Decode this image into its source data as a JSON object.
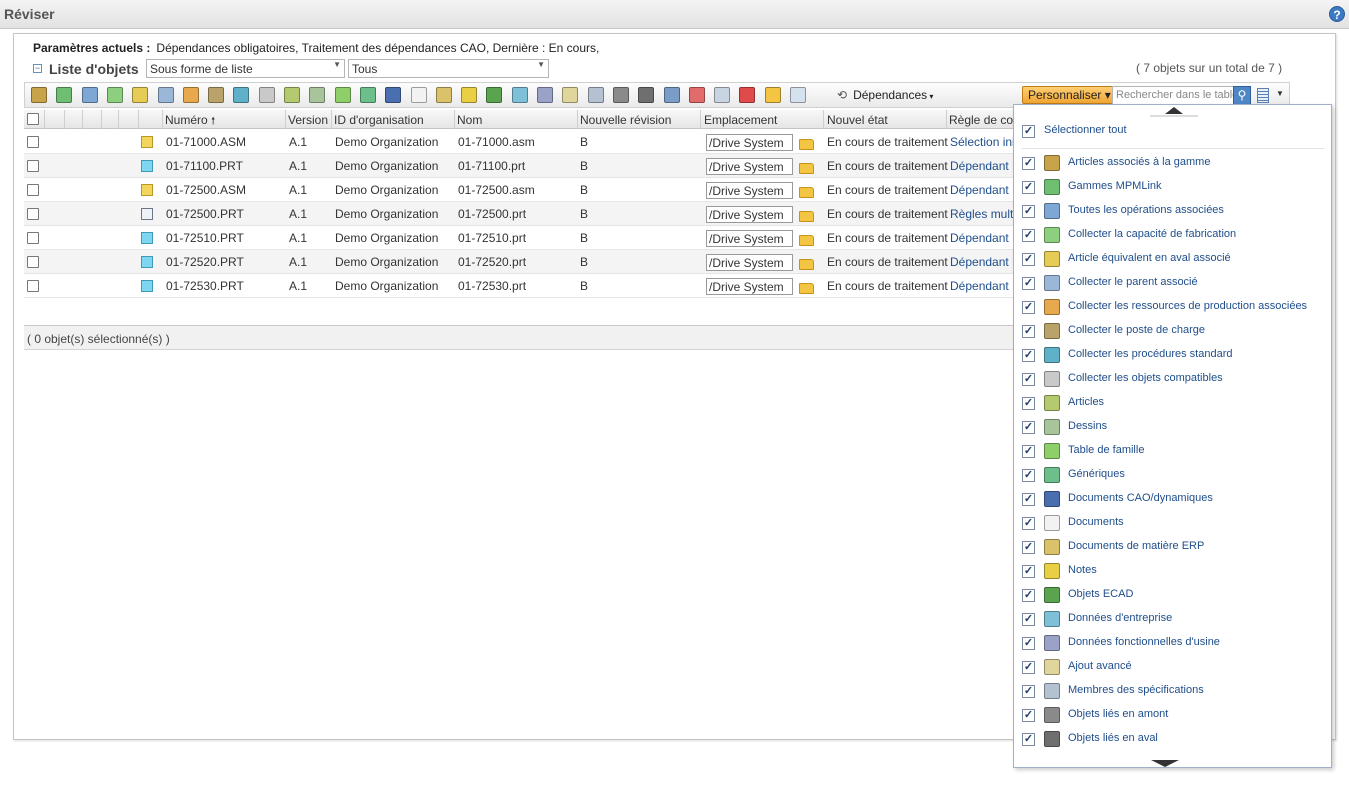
{
  "titlebar": {
    "title": "Réviser",
    "help": "?"
  },
  "params": {
    "label": "Paramètres actuels :",
    "value": "Dépendances obligatoires, Traitement des dépendances CAO, Dernière : En cours,"
  },
  "list": {
    "title": "Liste d'objets",
    "view_select": "Sous forme de liste",
    "filter_select": "Tous",
    "count": "( 7 objets sur un total de 7 )"
  },
  "toolbar": {
    "dependances": "Dépendances",
    "personnaliser": "Personnaliser",
    "search_placeholder": "Rechercher dans le table"
  },
  "columns": [
    "Numéro",
    "Version",
    "ID d'organisation",
    "Nom",
    "Nouvelle révision",
    "Emplacement",
    "Nouvel état",
    "Règle de coll"
  ],
  "rows": [
    {
      "number": "01-71000.ASM",
      "version": "A.1",
      "org": "Demo Organization",
      "name": "01-71000.asm",
      "revision": "B",
      "location": "/Drive System",
      "state": "En cours de traitement",
      "rule": "Sélection init",
      "icon": "assembly-icon"
    },
    {
      "number": "01-71100.PRT",
      "version": "A.1",
      "org": "Demo Organization",
      "name": "01-71100.prt",
      "revision": "B",
      "location": "/Drive System",
      "state": "En cours de traitement",
      "rule": "Dépendant",
      "icon": "part-icon"
    },
    {
      "number": "01-72500.ASM",
      "version": "A.1",
      "org": "Demo Organization",
      "name": "01-72500.asm",
      "revision": "B",
      "location": "/Drive System",
      "state": "En cours de traitement",
      "rule": "Dépendant",
      "icon": "assembly-icon"
    },
    {
      "number": "01-72500.PRT",
      "version": "A.1",
      "org": "Demo Organization",
      "name": "01-72500.prt",
      "revision": "B",
      "location": "/Drive System",
      "state": "En cours de traitement",
      "rule": "Règles multip",
      "icon": "generic-part-icon"
    },
    {
      "number": "01-72510.PRT",
      "version": "A.1",
      "org": "Demo Organization",
      "name": "01-72510.prt",
      "revision": "B",
      "location": "/Drive System",
      "state": "En cours de traitement",
      "rule": "Dépendant",
      "icon": "part-icon"
    },
    {
      "number": "01-72520.PRT",
      "version": "A.1",
      "org": "Demo Organization",
      "name": "01-72520.prt",
      "revision": "B",
      "location": "/Drive System",
      "state": "En cours de traitement",
      "rule": "Dépendant",
      "icon": "part-icon"
    },
    {
      "number": "01-72530.PRT",
      "version": "A.1",
      "org": "Demo Organization",
      "name": "01-72530.prt",
      "revision": "B",
      "location": "/Drive System",
      "state": "En cours de traitement",
      "rule": "Dépendant",
      "icon": "part-icon"
    }
  ],
  "status": "( 0 objet(s) sélectionné(s) )",
  "dropdown": {
    "select_all": "Sélectionner tout",
    "items": [
      {
        "label": "Articles associés à la gamme",
        "icon": "gear-icon",
        "color": "#c9a34a"
      },
      {
        "label": "Gammes MPMLink",
        "icon": "routing-icon",
        "color": "#6fbf73"
      },
      {
        "label": "Toutes les opérations associées",
        "icon": "operations-icon",
        "color": "#7fa7d6"
      },
      {
        "label": "Collecter la capacité de fabrication",
        "icon": "capability-icon",
        "color": "#8ccf7e"
      },
      {
        "label": "Article équivalent en aval associé",
        "icon": "equivalent-icon",
        "color": "#e6cc55"
      },
      {
        "label": "Collecter le parent associé",
        "icon": "parent-icon",
        "color": "#9bb7d8"
      },
      {
        "label": "Collecter les ressources de production associées",
        "icon": "resource-icon",
        "color": "#e8a94e"
      },
      {
        "label": "Collecter le poste de charge",
        "icon": "workcenter-icon",
        "color": "#b9a36b"
      },
      {
        "label": "Collecter les procédures standard",
        "icon": "procedure-icon",
        "color": "#5fb0c9"
      },
      {
        "label": "Collecter les objets compatibles",
        "icon": "compatible-icon",
        "color": "#c9c9c9"
      },
      {
        "label": "Articles",
        "icon": "part-gear-icon",
        "color": "#b5c96e"
      },
      {
        "label": "Dessins",
        "icon": "drawing-icon",
        "color": "#a8c49a"
      },
      {
        "label": "Table de famille",
        "icon": "family-table-icon",
        "color": "#8fcf6a"
      },
      {
        "label": "Génériques",
        "icon": "generic-icon",
        "color": "#6cbf8a"
      },
      {
        "label": "Documents CAO/dynamiques",
        "icon": "cad-document-icon",
        "color": "#4a6fb0"
      },
      {
        "label": "Documents",
        "icon": "document-icon",
        "color": "#f2f2f2"
      },
      {
        "label": "Documents de matière ERP",
        "icon": "erp-icon",
        "color": "#d9c26a"
      },
      {
        "label": "Notes",
        "icon": "note-icon",
        "color": "#e8cf44"
      },
      {
        "label": "Objets ECAD",
        "icon": "ecad-icon",
        "color": "#5aa44f"
      },
      {
        "label": "Données d'entreprise",
        "icon": "enterprise-data-icon",
        "color": "#7ec0d8"
      },
      {
        "label": "Données fonctionnelles d'usine",
        "icon": "plant-data-icon",
        "color": "#9aa2c8"
      },
      {
        "label": "Ajout avancé",
        "icon": "advanced-add-icon",
        "color": "#e0d59a"
      },
      {
        "label": "Membres des spécifications",
        "icon": "spec-members-icon",
        "color": "#b3c1d1"
      },
      {
        "label": "Objets liés en amont",
        "icon": "upstream-icon",
        "color": "#8a8a8a"
      },
      {
        "label": "Objets liés en aval",
        "icon": "downstream-icon",
        "color": "#6f6f6f"
      }
    ]
  },
  "toolbar_icons": [
    {
      "name": "gear-icon",
      "color": "#c9a34a"
    },
    {
      "name": "routing-icon",
      "color": "#6fbf73"
    },
    {
      "name": "operations-icon",
      "color": "#7fa7d6"
    },
    {
      "name": "capability-icon",
      "color": "#8ccf7e"
    },
    {
      "name": "equivalent-icon",
      "color": "#e6cc55"
    },
    {
      "name": "parent-icon",
      "color": "#9bb7d8"
    },
    {
      "name": "resource-icon",
      "color": "#e8a94e"
    },
    {
      "name": "workcenter-icon",
      "color": "#b9a36b"
    },
    {
      "name": "procedure-icon",
      "color": "#5fb0c9"
    },
    {
      "name": "compatible-icon",
      "color": "#c9c9c9"
    },
    {
      "name": "part-gear-icon",
      "color": "#b5c96e"
    },
    {
      "name": "drawing-icon",
      "color": "#a8c49a"
    },
    {
      "name": "family-table-icon",
      "color": "#8fcf6a"
    },
    {
      "name": "generic-icon",
      "color": "#6cbf8a"
    },
    {
      "name": "cad-document-icon",
      "color": "#4a6fb0"
    },
    {
      "name": "document-icon",
      "color": "#f2f2f2"
    },
    {
      "name": "erp-icon",
      "color": "#d9c26a"
    },
    {
      "name": "note-icon",
      "color": "#e8cf44"
    },
    {
      "name": "ecad-icon",
      "color": "#5aa44f"
    },
    {
      "name": "enterprise-data-icon",
      "color": "#7ec0d8"
    },
    {
      "name": "plant-data-icon",
      "color": "#9aa2c8"
    },
    {
      "name": "advanced-add-icon",
      "color": "#e0d59a"
    },
    {
      "name": "spec-members-icon",
      "color": "#b3c1d1"
    },
    {
      "name": "upstream-icon",
      "color": "#8a8a8a"
    },
    {
      "name": "downstream-icon",
      "color": "#6f6f6f"
    },
    {
      "name": "globe-icon",
      "color": "#7a9cc8"
    },
    {
      "name": "clear-icon",
      "color": "#e26b6b"
    },
    {
      "name": "pages-icon",
      "color": "#c9d4e2"
    },
    {
      "name": "remove-icon",
      "color": "#e04a4a"
    },
    {
      "name": "folder-icon",
      "color": "#f4c542"
    },
    {
      "name": "checklist-icon",
      "color": "#d6e1ee"
    }
  ]
}
